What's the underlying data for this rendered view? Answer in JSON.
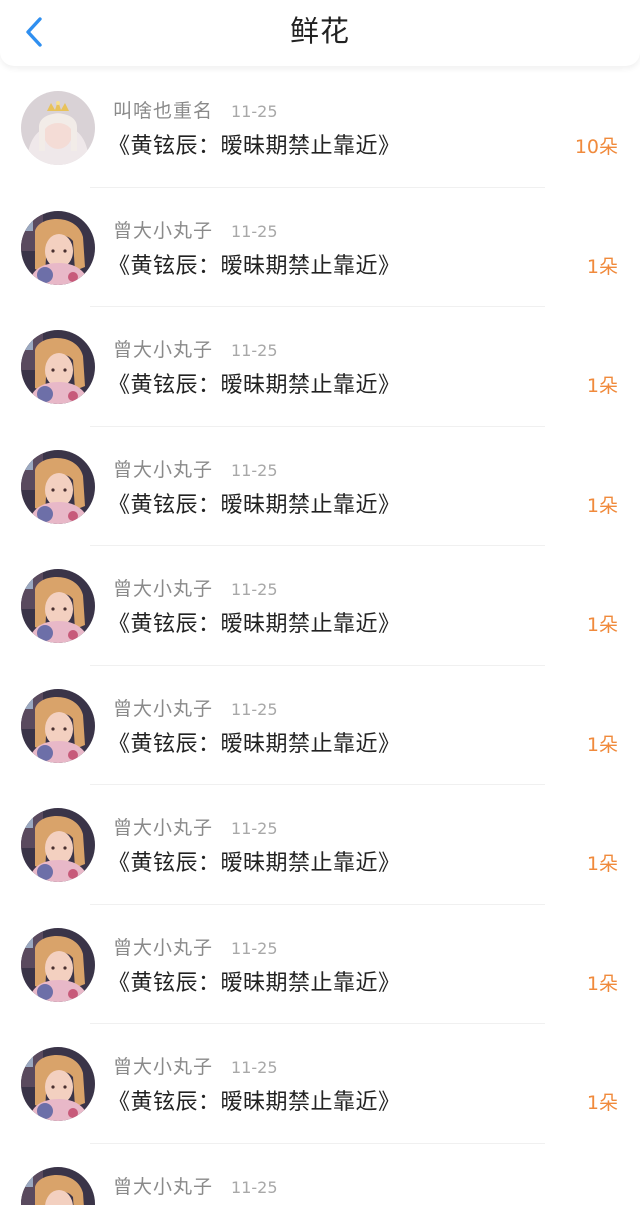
{
  "header": {
    "title": "鲜花",
    "back_icon": "chevron-left-icon",
    "accent_color": "#2f8ff0"
  },
  "colors": {
    "count_text": "#f08a3c",
    "username_text": "#8a8a8a"
  },
  "items": [
    {
      "avatar": "crown-girl-avatar",
      "username": "叫啥也重名",
      "date": "11-25",
      "title": "《黄铉辰：暧昧期禁止靠近》",
      "count": "10朵"
    },
    {
      "avatar": "girl-avatar",
      "username": "曾大小丸子",
      "date": "11-25",
      "title": "《黄铉辰：暧昧期禁止靠近》",
      "count": "1朵"
    },
    {
      "avatar": "girl-avatar",
      "username": "曾大小丸子",
      "date": "11-25",
      "title": "《黄铉辰：暧昧期禁止靠近》",
      "count": "1朵"
    },
    {
      "avatar": "girl-avatar",
      "username": "曾大小丸子",
      "date": "11-25",
      "title": "《黄铉辰：暧昧期禁止靠近》",
      "count": "1朵"
    },
    {
      "avatar": "girl-avatar",
      "username": "曾大小丸子",
      "date": "11-25",
      "title": "《黄铉辰：暧昧期禁止靠近》",
      "count": "1朵"
    },
    {
      "avatar": "girl-avatar",
      "username": "曾大小丸子",
      "date": "11-25",
      "title": "《黄铉辰：暧昧期禁止靠近》",
      "count": "1朵"
    },
    {
      "avatar": "girl-avatar",
      "username": "曾大小丸子",
      "date": "11-25",
      "title": "《黄铉辰：暧昧期禁止靠近》",
      "count": "1朵"
    },
    {
      "avatar": "girl-avatar",
      "username": "曾大小丸子",
      "date": "11-25",
      "title": "《黄铉辰：暧昧期禁止靠近》",
      "count": "1朵"
    },
    {
      "avatar": "girl-avatar",
      "username": "曾大小丸子",
      "date": "11-25",
      "title": "《黄铉辰：暧昧期禁止靠近》",
      "count": "1朵"
    },
    {
      "avatar": "girl-avatar",
      "username": "曾大小丸子",
      "date": "11-25",
      "title": "",
      "count": ""
    }
  ]
}
